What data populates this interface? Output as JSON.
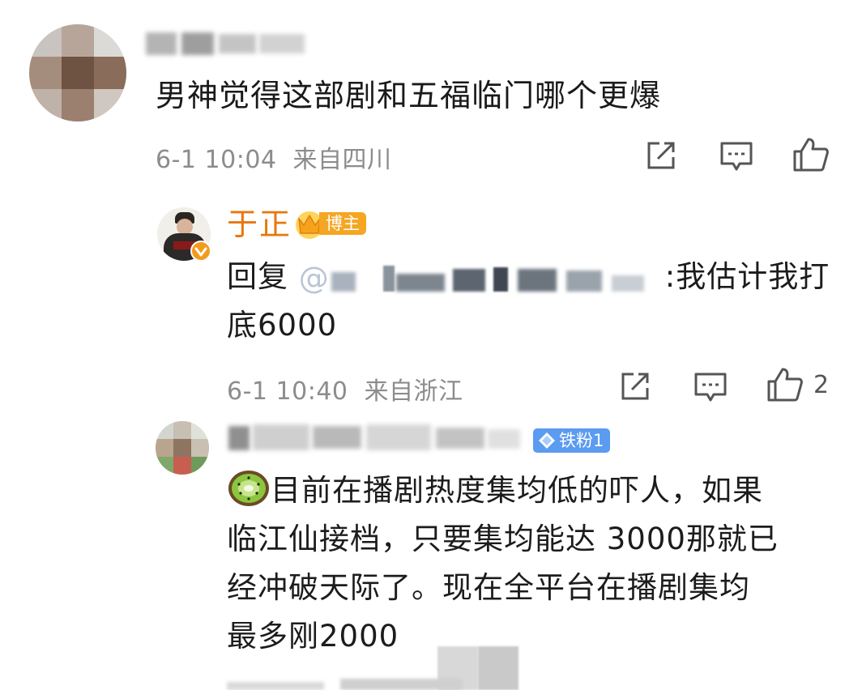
{
  "comments": [
    {
      "text": "男神觉得这部剧和五福临门哪个更爆",
      "time": "6-1 10:04",
      "location": "来自四川"
    },
    {
      "author": "于正",
      "badge": "博主",
      "reply_prefix": "回复",
      "reply_at": "@",
      "text_line1": ":我估计我打",
      "text_line2": "底6000",
      "time": "6-1 10:40",
      "location": "来自浙江",
      "likes": "2"
    },
    {
      "badge": "铁粉1",
      "lines": [
        "目前在播剧热度集均低的吓人，如果",
        "临江仙接档，只要集均能达 3000那就已",
        "经冲破天际了。现在全平台在播剧集均",
        "最多刚2000"
      ]
    }
  ],
  "colors": {
    "author": "#e8770e",
    "meta": "#8c8c8c",
    "badge_gold": "#f5a623",
    "badge_blue": "#5b9bf0"
  },
  "icons": [
    "share-icon",
    "comment-icon",
    "like-icon",
    "verified-icon",
    "crown-icon",
    "diamond-icon",
    "kiwi-emoji-icon"
  ]
}
